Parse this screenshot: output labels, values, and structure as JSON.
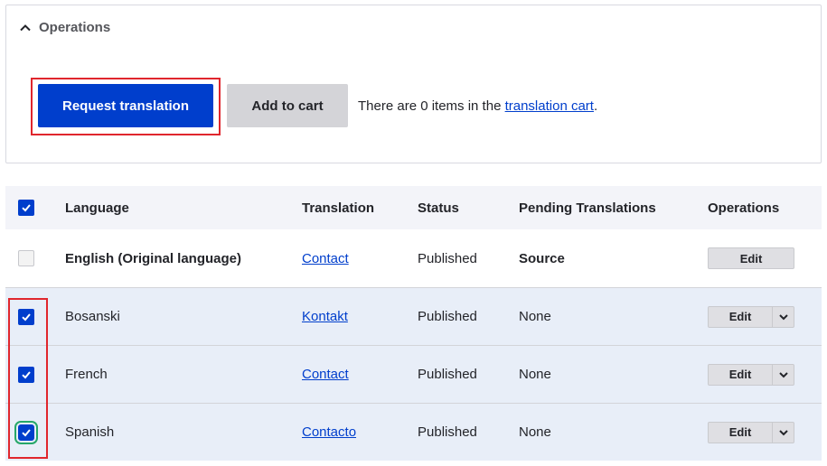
{
  "panel": {
    "title": "Operations",
    "request_button": "Request translation",
    "add_cart_button": "Add to cart",
    "cart_prefix": "There are 0 items in the ",
    "cart_link": "translation cart",
    "cart_suffix": "."
  },
  "table": {
    "headers": {
      "language": "Language",
      "translation": "Translation",
      "status": "Status",
      "pending": "Pending Translations",
      "operations": "Operations"
    },
    "header_checked": true,
    "rows": [
      {
        "language": "English (Original language)",
        "translation": "Contact",
        "status": "Published",
        "pending": "Source",
        "operation": "Edit",
        "checked": false
      },
      {
        "language": "Bosanski",
        "translation": "Kontakt",
        "status": "Published",
        "pending": "None",
        "operation": "Edit",
        "checked": true
      },
      {
        "language": "French",
        "translation": "Contact",
        "status": "Published",
        "pending": "None",
        "operation": "Edit",
        "checked": true
      },
      {
        "language": "Spanish",
        "translation": "Contacto",
        "status": "Published",
        "pending": "None",
        "operation": "Edit",
        "checked": true
      }
    ]
  },
  "colors": {
    "primary": "#003ecc",
    "highlight": "#e0262d",
    "focus": "#26a769",
    "selected_row": "#e8eef8"
  },
  "icons": {
    "panel_toggle": "chevron-up-icon",
    "checkbox_check": "checkmark-icon",
    "dropdown": "chevron-down-icon"
  }
}
